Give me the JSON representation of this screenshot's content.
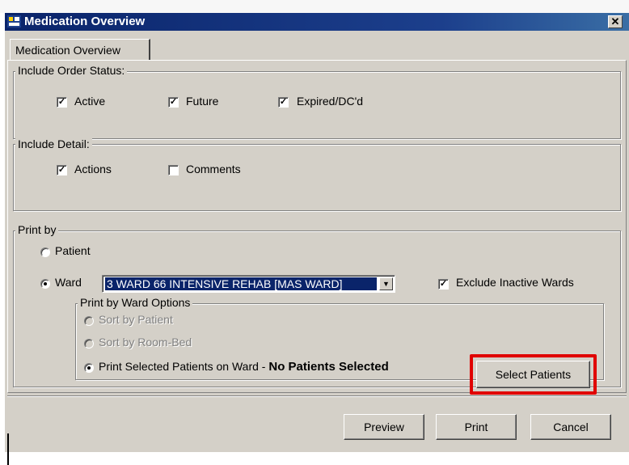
{
  "window": {
    "title": "Medication Overview",
    "close_glyph": "✕"
  },
  "tab": {
    "label": "Medication Overview"
  },
  "order_status": {
    "legend": "Include Order Status:",
    "items": [
      {
        "label": "Active",
        "checked": true
      },
      {
        "label": "Future",
        "checked": true
      },
      {
        "label": "Expired/DC'd",
        "checked": true
      }
    ]
  },
  "detail": {
    "legend": "Include Detail:",
    "items": [
      {
        "label": "Actions",
        "checked": true
      },
      {
        "label": "Comments",
        "checked": false
      }
    ]
  },
  "print_by": {
    "legend": "Print by",
    "patient_label": "Patient",
    "ward_label": "Ward",
    "selected": "Ward",
    "ward_value": "3 WARD 66 INTENSIVE REHAB [MAS WARD]",
    "exclude_inactive_label": "Exclude Inactive Wards",
    "exclude_inactive_checked": true
  },
  "ward_options": {
    "legend": "Print by Ward Options",
    "sort_patient": "Sort by Patient",
    "sort_roombed": "Sort by Room-Bed",
    "print_selected_prefix": "Print Selected Patients on Ward - ",
    "print_selected_status": "No Patients Selected",
    "select_patients_button": "Select Patients"
  },
  "footer": {
    "preview": "Preview",
    "print": "Print",
    "cancel": "Cancel"
  },
  "colors": {
    "title_bar": "#0a246a",
    "dialog_face": "#d4d0c8",
    "highlight_box": "#e00000"
  }
}
